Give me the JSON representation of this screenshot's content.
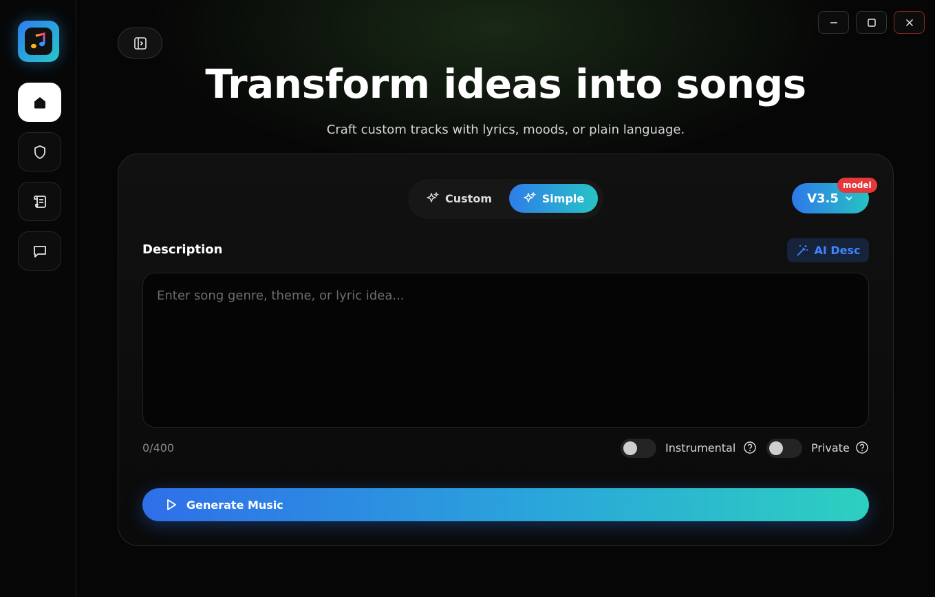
{
  "header": {
    "title": "Transform ideas into songs",
    "subtitle": "Craft custom tracks with lyrics, moods, or plain language."
  },
  "mode": {
    "options": [
      {
        "label": "Custom",
        "selected": false
      },
      {
        "label": "Simple",
        "selected": true
      }
    ]
  },
  "model": {
    "version": "V3.5",
    "badge": "model"
  },
  "description": {
    "label": "Description",
    "ai_button": "AI Desc",
    "placeholder": "Enter song genre, theme, or lyric idea...",
    "value": "",
    "counter": "0/400"
  },
  "options": {
    "instrumental": {
      "label": "Instrumental",
      "on": false
    },
    "private": {
      "label": "Private",
      "on": false
    }
  },
  "actions": {
    "generate_label": "Generate Music"
  },
  "colors": {
    "accent_start": "#2f7de8",
    "accent_end": "#27c4c6",
    "badge_red": "#e5383b",
    "ai_desc_text": "#3f86ff"
  }
}
